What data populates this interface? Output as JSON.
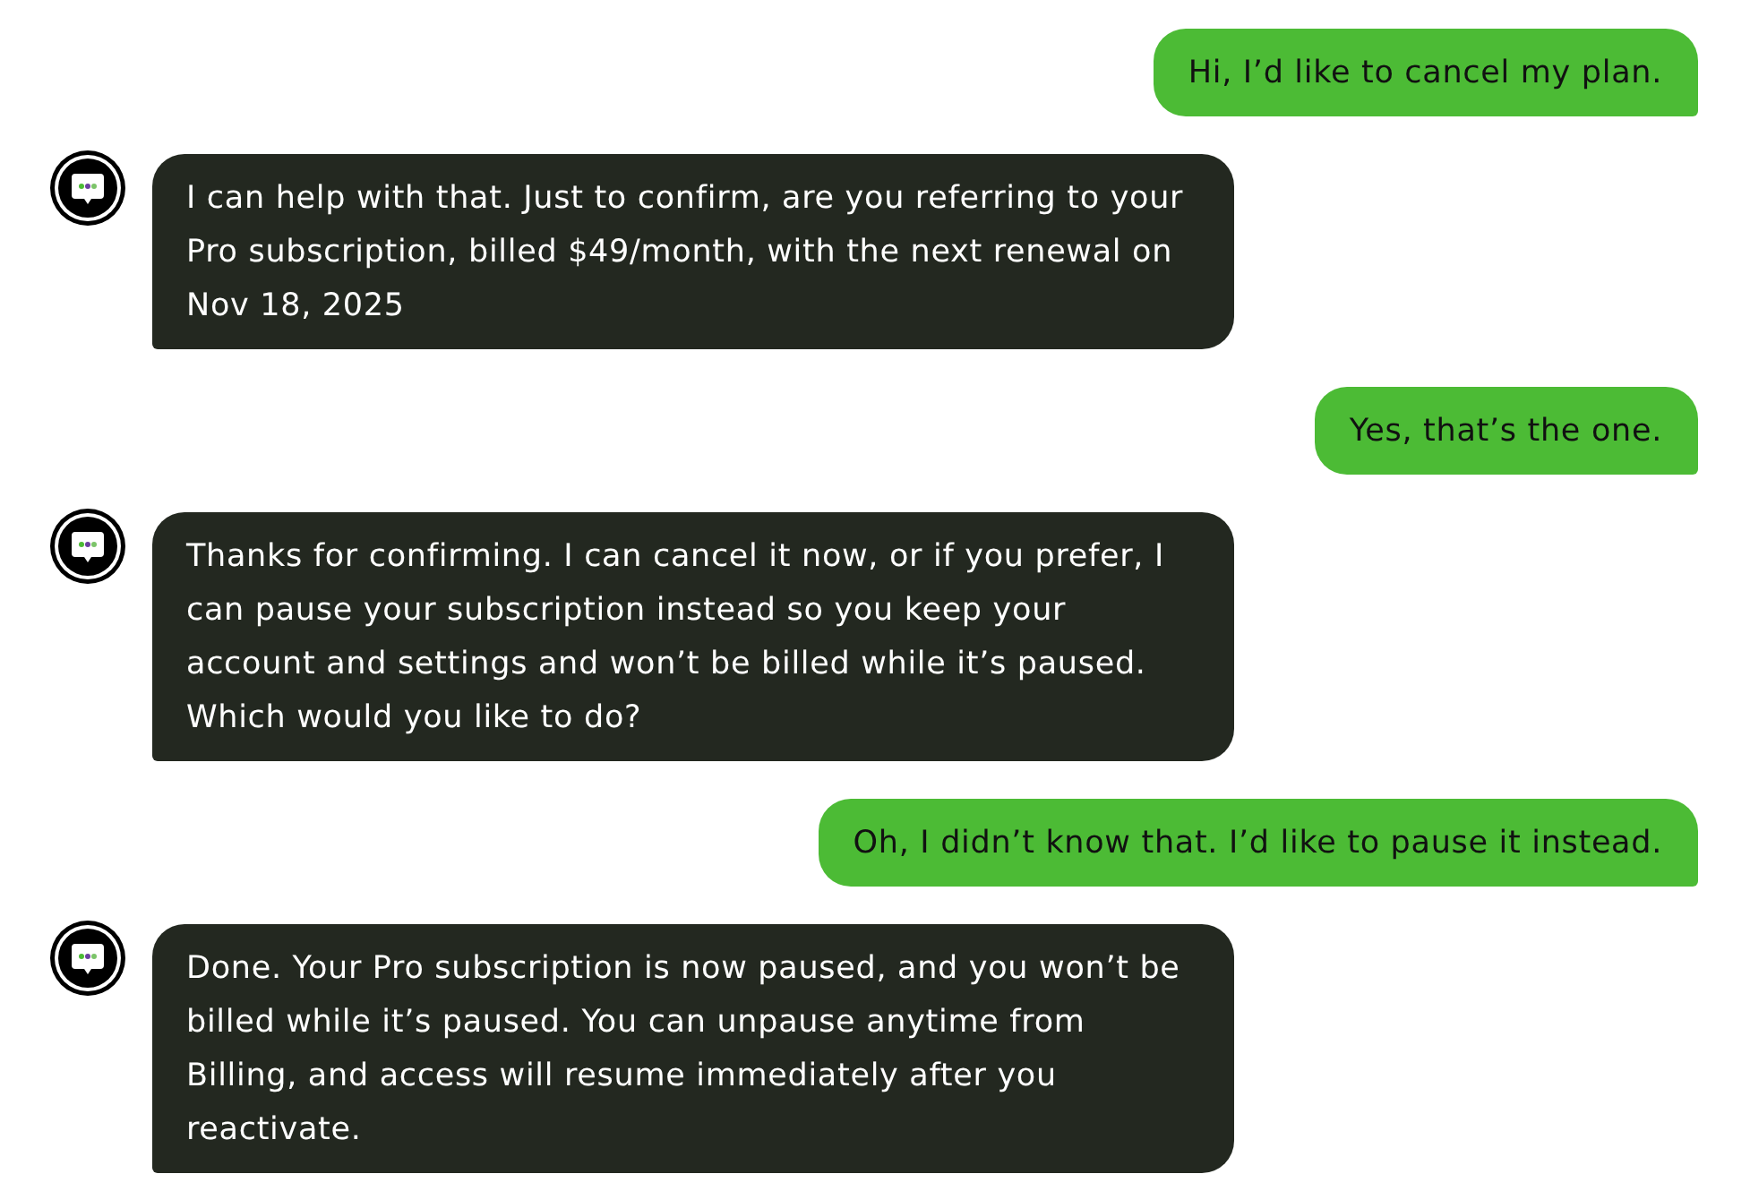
{
  "messages": [
    {
      "kind": "user",
      "text": "Hi, I’d like to cancel my plan."
    },
    {
      "kind": "bot",
      "text": "I can help with that. Just to confirm, are you referring to your Pro subscription, billed $49/month, with the next renewal on Nov 18, 2025"
    },
    {
      "kind": "user",
      "text": "Yes, that’s the one."
    },
    {
      "kind": "bot",
      "text": "Thanks for confirming. I can cancel it now, or if you prefer, I can pause your subscription instead so you keep your account and settings and won’t be billed while it’s paused. Which would you like to do?"
    },
    {
      "kind": "user",
      "text": "Oh, I didn’t know that. I’d like to pause it instead."
    },
    {
      "kind": "bot",
      "text": "Done. Your Pro subscription is now paused, and you won’t be billed while it’s paused. You can unpause anytime from Billing, and access will resume immediately after you reactivate."
    }
  ]
}
